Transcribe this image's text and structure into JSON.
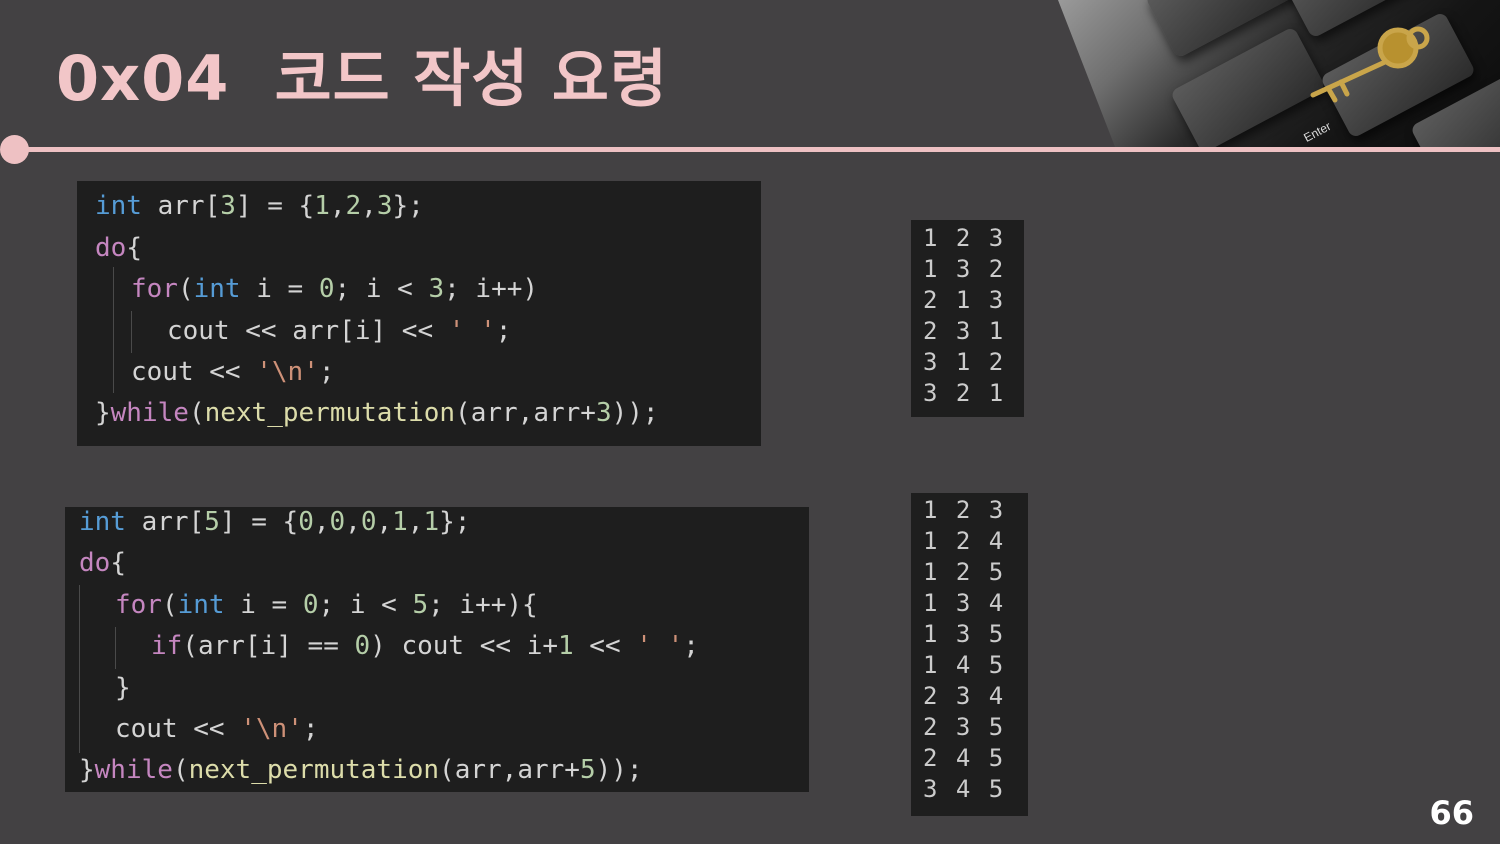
{
  "slide": {
    "title": "0x04  코드 작성 요령",
    "page_number": "66"
  },
  "photo": {
    "key_labels": [
      "Enter"
    ]
  },
  "code1": {
    "lines": [
      [
        "int",
        " arr[",
        "3",
        "] = {",
        "1",
        ",",
        "2",
        ",",
        "3",
        "};"
      ],
      [
        "do",
        "{"
      ],
      [
        "for",
        "(",
        "int",
        " i = ",
        "0",
        "; i < ",
        "3",
        "; i++)"
      ],
      [
        "cout << arr[i] << ",
        "' '",
        ";"
      ],
      [
        "cout << ",
        "'\\n'",
        ";"
      ],
      [
        "}",
        "while",
        "(",
        "next_permutation",
        "(arr,arr+",
        "3",
        "));"
      ]
    ]
  },
  "code2": {
    "lines": [
      [
        "int",
        " arr[",
        "5",
        "] = {",
        "0",
        ",",
        "0",
        ",",
        "0",
        ",",
        "1",
        ",",
        "1",
        "};"
      ],
      [
        "do",
        "{"
      ],
      [
        "for",
        "(",
        "int",
        " i = ",
        "0",
        "; i < ",
        "5",
        "; i++){"
      ],
      [
        "if",
        "(arr[i] == ",
        "0",
        ") cout << i+",
        "1",
        " << ",
        "' '",
        ";"
      ],
      [
        "}"
      ],
      [
        "cout << ",
        "'\\n'",
        ";"
      ],
      [
        "}",
        "while",
        "(",
        "next_permutation",
        "(arr,arr+",
        "5",
        "));"
      ]
    ]
  },
  "output1": [
    "1 2 3",
    "1 3 2",
    "2 1 3",
    "2 3 1",
    "3 1 2",
    "3 2 1"
  ],
  "output2": [
    "1 2 3",
    "1 2 4",
    "1 2 5",
    "1 3 4",
    "1 3 5",
    "1 4 5",
    "2 3 4",
    "2 3 5",
    "2 4 5",
    "3 4 5"
  ],
  "colors": {
    "title": "#f2c6c8",
    "accent_rule": "#eec1c3",
    "background": "#434143",
    "code_bg": "#1e1e1e",
    "keyword_blue": "#569cd6",
    "keyword_pink": "#c586c0",
    "number": "#b5cea8",
    "string": "#ce9178",
    "function": "#dcdcaa"
  }
}
